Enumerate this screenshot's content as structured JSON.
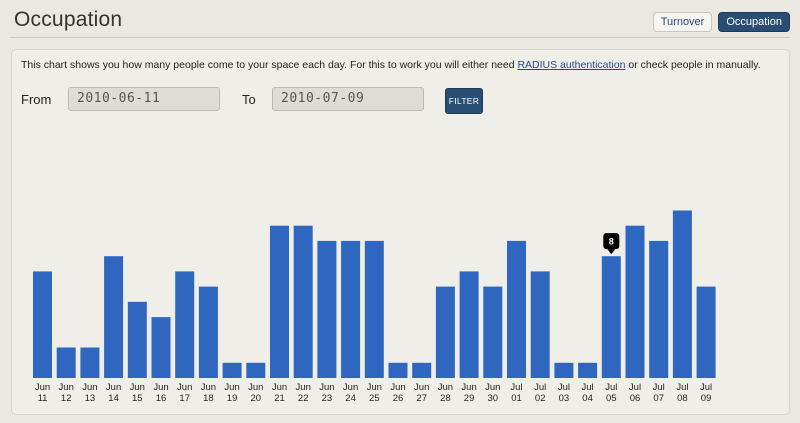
{
  "header": {
    "title": "Occupation",
    "tabs": [
      {
        "label": "Turnover",
        "active": false
      },
      {
        "label": "Occupation",
        "active": true
      }
    ]
  },
  "intro": {
    "text_before": "This chart shows you how many people come to your space each day. For this to work you will either need ",
    "link_text": "RADIUS authentication",
    "text_after": " or check people in manually."
  },
  "filter": {
    "from_label": "From",
    "from_value": "2010-06-11",
    "to_label": "To",
    "to_value": "2010-07-09",
    "button_label": "FILTER"
  },
  "colors": {
    "bar": "#2f67c0",
    "accent": "#2a4d73"
  },
  "chart_data": {
    "type": "bar",
    "categories": [
      "Jun 11",
      "Jun 12",
      "Jun 13",
      "Jun 14",
      "Jun 15",
      "Jun 16",
      "Jun 17",
      "Jun 18",
      "Jun 19",
      "Jun 20",
      "Jun 21",
      "Jun 22",
      "Jun 23",
      "Jun 24",
      "Jun 25",
      "Jun 26",
      "Jun 27",
      "Jun 28",
      "Jun 29",
      "Jun 30",
      "Jul 01",
      "Jul 02",
      "Jul 03",
      "Jul 04",
      "Jul 05",
      "Jul 06",
      "Jul 07",
      "Jul 08",
      "Jul 09"
    ],
    "values": [
      7,
      2,
      2,
      8,
      5,
      4,
      7,
      6,
      1,
      1,
      10,
      10,
      9,
      9,
      9,
      1,
      1,
      6,
      7,
      6,
      9,
      7,
      1,
      1,
      8,
      10,
      9,
      11,
      6
    ],
    "tooltip": {
      "category": "Jul 05",
      "value": "8"
    },
    "ylim": [
      0,
      13
    ],
    "grid": false
  }
}
